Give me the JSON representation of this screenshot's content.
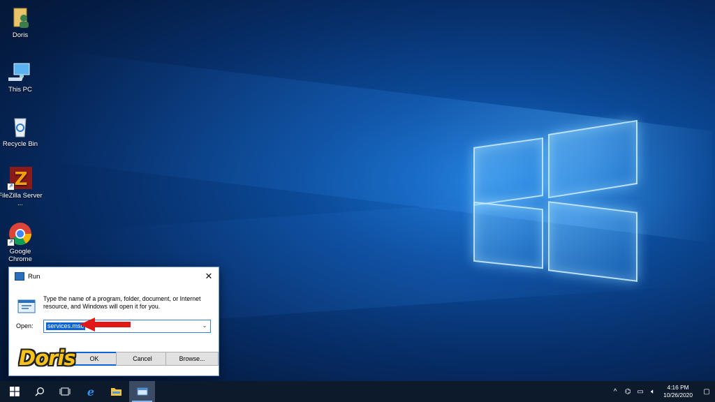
{
  "desktop": {
    "icons": [
      {
        "label": "Doris",
        "icon": "user-folder-icon"
      },
      {
        "label": "This PC",
        "icon": "computer-icon"
      },
      {
        "label": "Recycle Bin",
        "icon": "recycle-bin-icon"
      },
      {
        "label": "FileZilla Server ...",
        "icon": "filezilla-icon"
      },
      {
        "label": "Google Chrome",
        "icon": "chrome-icon"
      }
    ]
  },
  "run_dialog": {
    "title": "Run",
    "description": "Type the name of a program, folder, document, or Internet resource, and Windows will open it for you.",
    "open_label": "Open:",
    "open_value": "services.msc",
    "ok_label": "OK",
    "cancel_label": "Cancel",
    "browse_label": "Browse..."
  },
  "watermark": "Doris",
  "taskbar": {
    "items": [
      "start-icon",
      "search-icon",
      "task-view-icon",
      "edge-icon",
      "file-explorer-icon",
      "run-icon"
    ],
    "time": "4:16 PM",
    "date": "10/26/2020"
  },
  "colors": {
    "accent": "#0a64d8",
    "taskbar_bg": "#0d1a2c",
    "watermark": "#f7c319"
  }
}
